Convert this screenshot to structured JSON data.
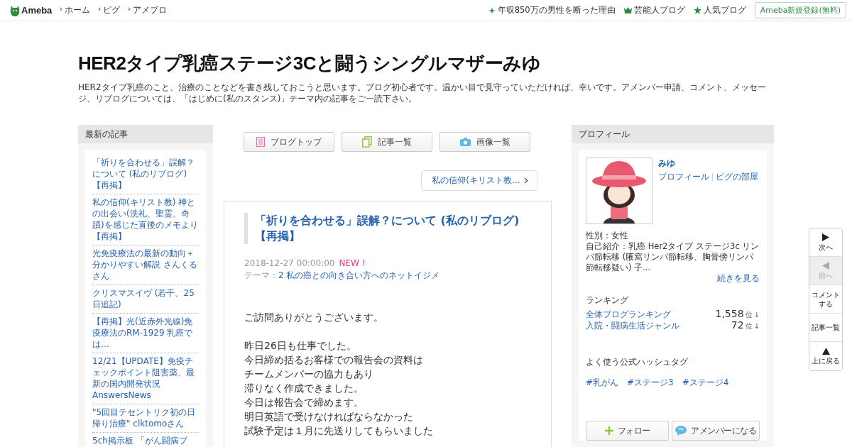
{
  "header": {
    "logo": "Ameba",
    "nav": [
      "ホーム",
      "ピグ",
      "アメブロ"
    ],
    "links": [
      {
        "kind": "sparkle",
        "label": "年収850万の男性を断った理由"
      },
      {
        "kind": "crown",
        "label": "芸能人ブログ"
      },
      {
        "kind": "star",
        "label": "人気ブログ"
      }
    ],
    "register": "Ameba新規登録(無料)"
  },
  "blog": {
    "title": "HER2タイプ乳癌ステージ3Cと闘うシングルマザーみゆ",
    "description": "HER2タイプ乳癌のこと、治療のことなどを書き残しておこうと思います。ブログ初心者です。温かい目で見守っていただければ、幸いです。アメンバー申請、コメント、メッセージ、リブログについては、「はじめに(私のスタンス)」テーマ内の記事をご一読下さい。"
  },
  "recent": {
    "heading": "最新の記事",
    "items": [
      "「祈りを合わせる」誤解？について (私のリブログ)【再掲】",
      "私の信仰(キリスト教) 神との出会い(洗礼、聖霊、奇蹟)を感じた直後のメモより【再掲】",
      "光免疫療法の最新の動向＋分かりやすい解説 さんくるさん",
      "クリスマスイヴ (若干、25日追記)",
      "【再掲】光(近赤外光線)免疫療法のRM-1929 乳癌では…",
      "12/21【UPDATE】免疫チェックポイント阻害薬、最新の国内開発状況 AnswersNews",
      "\"5回目テセントリク初の日帰り治療\" clktomoさん",
      "5ch掲示板 「がん闘病ブ"
    ]
  },
  "tabs": [
    {
      "kind": "list",
      "label": "ブログトップ"
    },
    {
      "kind": "pages",
      "label": "記事一覧"
    },
    {
      "kind": "camera",
      "label": "画像一覧"
    }
  ],
  "next_article": "私の信仰(キリスト教…",
  "article": {
    "title": "「祈りを合わせる」誤解？について (私のリブログ)【再掲】",
    "date": "2018-12-27 00:00:00",
    "is_new": true,
    "new_label": "NEW !",
    "theme_label": "テーマ：",
    "theme": "2 私の癌との向き合い方へのネットイジメ",
    "paragraphs": [
      [
        "ご訪問ありがとうございます。"
      ],
      [
        "昨日26日も仕事でした。",
        "今日締め括るお客様での報告会の資料は",
        "チームメンバーの協力もあり",
        "滞りなく作成できました。",
        "今日は報告会で締めます。",
        "明日英語で受けなければならなかった",
        "試験予定は１月に先送りしてもらいました"
      ]
    ]
  },
  "profile": {
    "heading": "プロフィール",
    "name": "みゆ",
    "links": [
      "プロフィール",
      "ピグの部屋"
    ],
    "gender": "性別：女性",
    "intro": "自己紹介：乳癌 Her2タイプ ステージ3c リンパ節転移 (腋窩リンパ節転移、胸骨傍リンパ節転移疑い) 子...",
    "more": "続きを見る",
    "ranking_heading": "ランキング",
    "rankings": [
      {
        "label": "全体ブログランキング",
        "rank": "1,558",
        "unit": "位",
        "trend": "↓"
      },
      {
        "label": "入院・闘病生活ジャンル",
        "rank": "72",
        "unit": "位",
        "trend": "↓"
      }
    ],
    "hashtag_heading": "よく使う公式ハッシュタグ",
    "hashtags": [
      "#乳がん",
      "#ステージ3",
      "#ステージ4"
    ],
    "follow": "フォロー",
    "amember": "アメンバーになる"
  },
  "side_nav": [
    {
      "kind": "next",
      "label": "次へ",
      "disabled": false
    },
    {
      "kind": "prev",
      "label": "前へ",
      "disabled": true
    },
    {
      "kind": "text",
      "label": "コメントする",
      "disabled": false
    },
    {
      "kind": "text",
      "label": "記事一覧",
      "disabled": false
    },
    {
      "kind": "top",
      "label": "上に戻る",
      "disabled": false
    }
  ]
}
